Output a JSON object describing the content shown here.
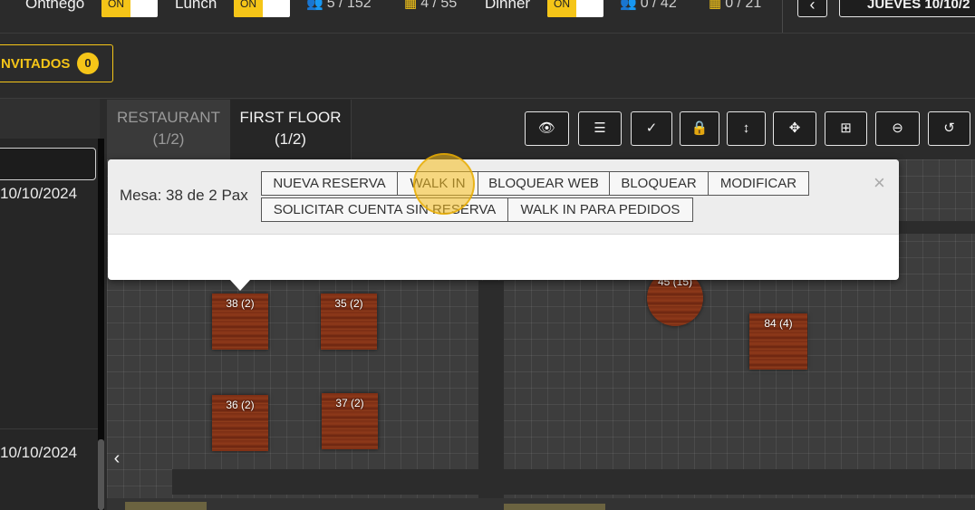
{
  "topbar": {
    "service1_label": "Onthego",
    "service2_label": "Lunch",
    "service3_label": "Dinner",
    "toggle_on": "ON",
    "lunch_guests": "5 / 152",
    "lunch_tables": "4 / 55",
    "dinner_guests": "0 / 42",
    "dinner_tables": "0 / 21",
    "prev_icon": "‹",
    "date_label": "JUEVES 10/10/2",
    "guests_icon": "users-icon",
    "tables_icon": "tables-icon"
  },
  "invitados": {
    "label": "NVITADOS",
    "count": "0"
  },
  "left_panel": {
    "date1": "10/10/2024",
    "date2": "10/10/2024",
    "collapse_icon": "‹"
  },
  "tabs": [
    {
      "line1": "RESTAURANT",
      "line2": "(1/2)"
    },
    {
      "line1": "FIRST FLOOR",
      "line2": "(1/2)"
    }
  ],
  "toolbar": [
    {
      "icon": "eye-slash-icon",
      "glyph": "👁"
    },
    {
      "icon": "list-icon",
      "glyph": "☰"
    },
    {
      "icon": "check-circle-icon",
      "glyph": "✓"
    },
    {
      "icon": "lock-icon",
      "glyph": "🔒"
    },
    {
      "icon": "resize-vertical-icon",
      "glyph": "↕"
    },
    {
      "icon": "move-icon",
      "glyph": "✥"
    },
    {
      "icon": "plus-square-icon",
      "glyph": "⊞"
    },
    {
      "icon": "zoom-out-icon",
      "glyph": "⊖"
    },
    {
      "icon": "undo-icon",
      "glyph": "↺"
    }
  ],
  "tables": [
    {
      "label": "38 (2)"
    },
    {
      "label": "35 (2)"
    },
    {
      "label": "36 (2)"
    },
    {
      "label": "37 (2)"
    },
    {
      "label": "45 (15)"
    },
    {
      "label": "84 (4)"
    }
  ],
  "popup": {
    "mesa": "Mesa: 38 de 2 Pax",
    "close": "×",
    "buttons": [
      "NUEVA RESERVA",
      "WALK IN",
      "BLOQUEAR WEB",
      "BLOQUEAR",
      "MODIFICAR",
      "SOLICITAR CUENTA SIN RESERVA",
      "WALK IN PARA PEDIDOS"
    ]
  },
  "colors": {
    "accent": "#f5c518",
    "background": "#2b2b2b",
    "table_wood": "#7a2e14"
  }
}
